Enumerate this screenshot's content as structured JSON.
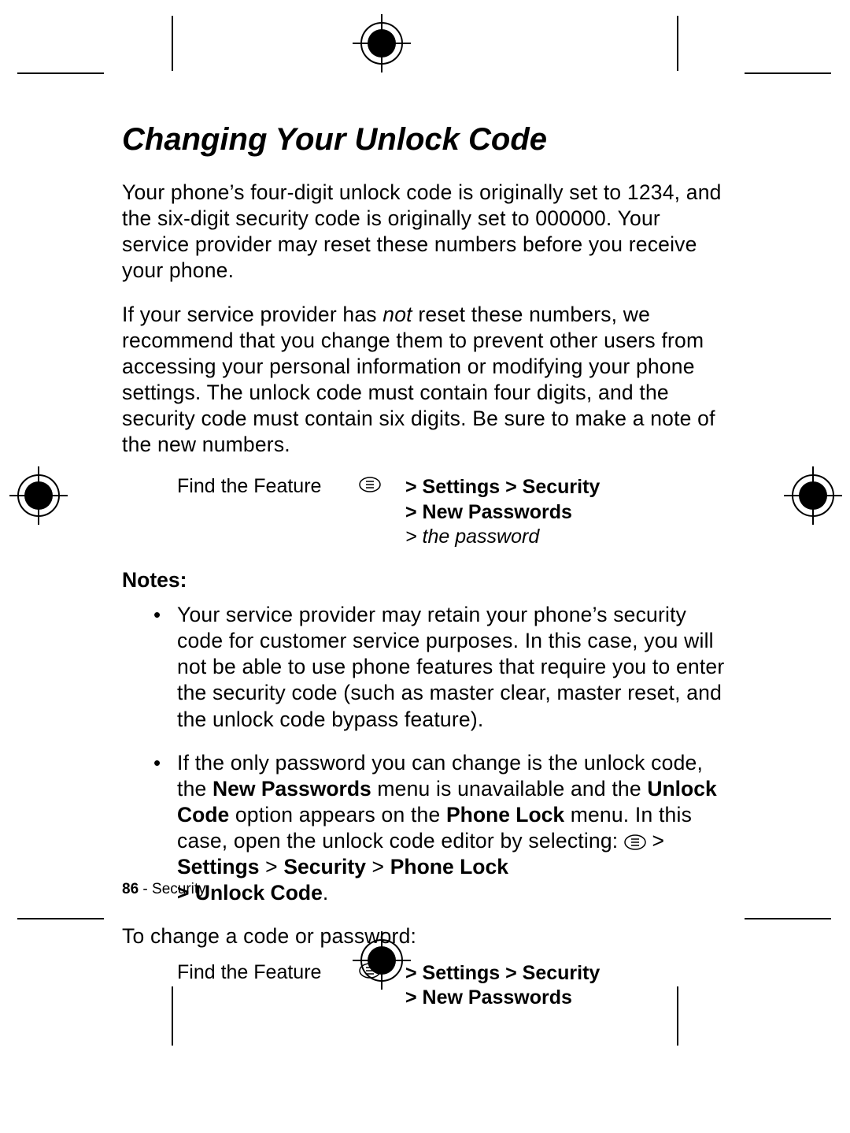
{
  "title": "Changing Your Unlock Code",
  "para1": "Your phone’s four-digit unlock code is originally set to 1234, and the six-digit security code is originally set to 000000. Your service provider may reset these numbers before you receive your phone.",
  "para2_pre": "If your service provider has ",
  "para2_not": "not",
  "para2_post": " reset these numbers, we recommend that you change them to prevent other users from accessing your personal information or modifying your phone settings. The unlock code must contain four digits, and the security code must contain six digits. Be sure to make a note of the new numbers.",
  "feature1": {
    "label": "Find the Feature",
    "path_line1": "> Settings > Security",
    "path_line2": "> New Passwords",
    "path_line3": "> the password"
  },
  "notes_label": "Notes:",
  "note1": "Your service provider may retain your phone’s security code for customer service purposes. In this case, you will not be able to use phone features that require you to enter the security code (such as master clear, master reset, and the unlock code bypass feature).",
  "note2": {
    "t1": "If the only password you can change is the unlock code, the ",
    "m1": "New Passwords",
    "t2": " menu is unavailable and the ",
    "m2": "Unlock Code",
    "t3": " option appears on the ",
    "m3": "Phone Lock",
    "t4": " menu. In this case, open the unlock code editor by selecting: ",
    "path1_a": " > ",
    "path1_b": "Settings",
    "path1_c": " > ",
    "path1_d": "Security",
    "path1_e": " > ",
    "path1_f": "Phone Lock",
    "path2_a": "> ",
    "path2_b": "Unlock Code",
    "period": "."
  },
  "para3": "To change a code or password:",
  "feature2": {
    "label": "Find the Feature",
    "path_line1": "> Settings > Security",
    "path_line2": "> New Passwords"
  },
  "footer": {
    "page": "86",
    "sep": " - ",
    "section": "Security"
  }
}
